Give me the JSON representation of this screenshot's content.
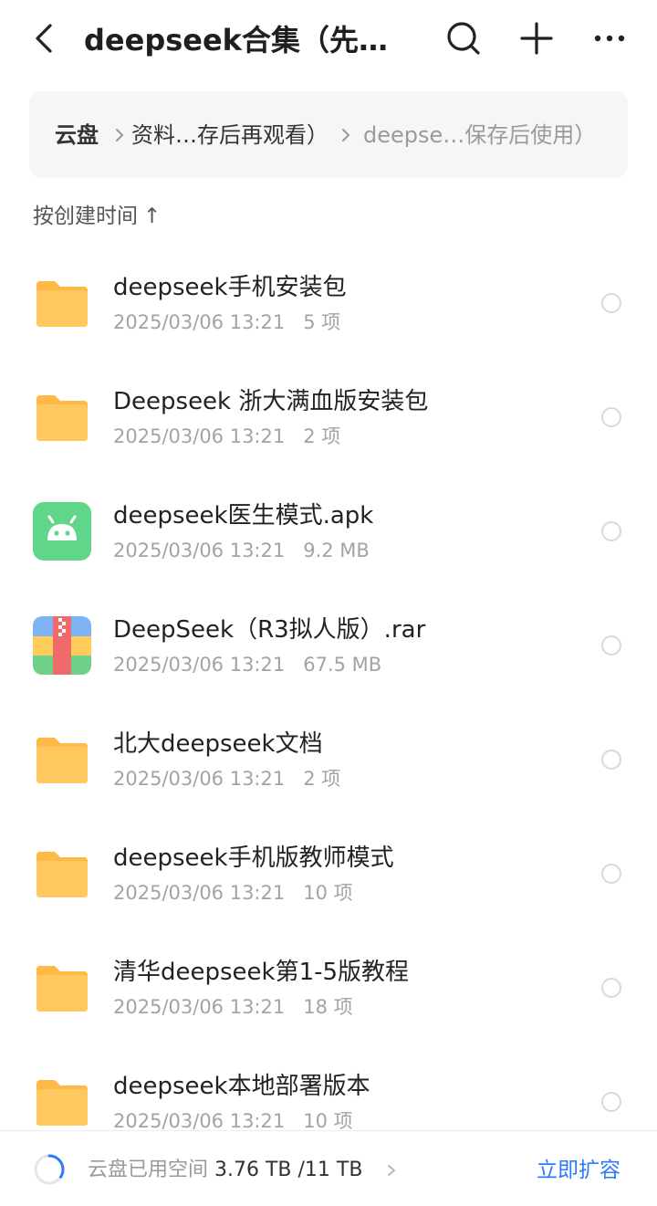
{
  "header": {
    "title": "deepseek合集（先…",
    "icons": {
      "back": "chevron-left-icon",
      "search": "search-icon",
      "add": "plus-icon",
      "more": "more-horizontal-icon"
    }
  },
  "breadcrumb": {
    "root": "云盘",
    "middle": "资料…存后再观看）",
    "current": "deepse…保存后使用）"
  },
  "sort": {
    "label": "按创建时间",
    "direction_glyph": "↑"
  },
  "files": [
    {
      "name": "deepseek手机安装包",
      "date": "2025/03/06 13:21",
      "info": "5 项",
      "type": "folder"
    },
    {
      "name": "Deepseek 浙大满血版安装包",
      "date": "2025/03/06 13:21",
      "info": "2 项",
      "type": "folder"
    },
    {
      "name": "deepseek医生模式.apk",
      "date": "2025/03/06 13:21",
      "info": "9.2 MB",
      "type": "apk"
    },
    {
      "name": "DeepSeek（R3拟人版）.rar",
      "date": "2025/03/06 13:21",
      "info": "67.5 MB",
      "type": "rar"
    },
    {
      "name": "北大deepseek文档",
      "date": "2025/03/06 13:21",
      "info": "2 项",
      "type": "folder"
    },
    {
      "name": "deepseek手机版教师模式",
      "date": "2025/03/06 13:21",
      "info": "10 项",
      "type": "folder"
    },
    {
      "name": "清华deepseek第1-5版教程",
      "date": "2025/03/06 13:21",
      "info": "18 项",
      "type": "folder"
    },
    {
      "name": "deepseek本地部署版本",
      "date": "2025/03/06 13:21",
      "info": "10 项",
      "type": "folder"
    }
  ],
  "footer": {
    "usage_label": "云盘已用空间",
    "usage_value": "3.76 TB /11 TB",
    "usage_fraction": 0.342,
    "expand_label": "立即扩容"
  },
  "colors": {
    "folder": "#ffc45a",
    "apk": "#5fd68a",
    "accent": "#2d7cf6"
  }
}
